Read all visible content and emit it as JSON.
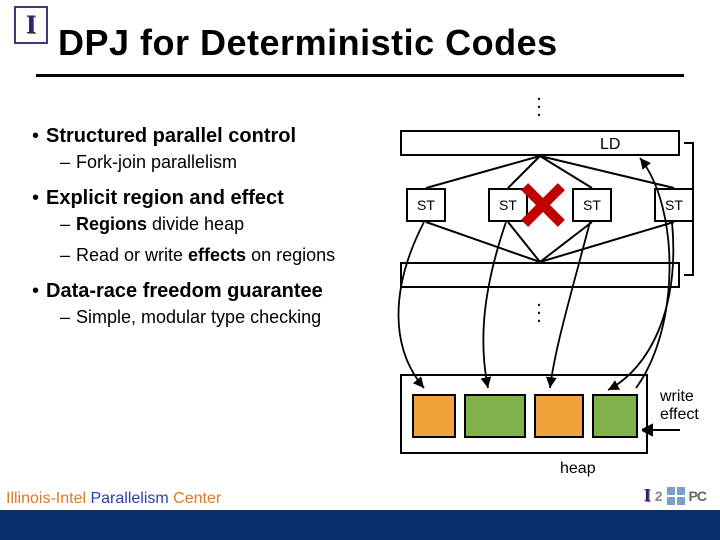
{
  "title": "DPJ for Deterministic Codes",
  "bullets": {
    "b1": "Structured parallel control",
    "b1s1": "Fork-join parallelism",
    "b2": "Explicit region and effect",
    "b2s1a": "Regions",
    "b2s1b": " divide heap",
    "b2s2a": "Read or write ",
    "b2s2b": "effects",
    "b2s2c": " on regions",
    "b3": "Data-race freedom guarantee",
    "b3s1": "Simple, modular type checking"
  },
  "diagram": {
    "ld": "LD",
    "st": "ST",
    "heap": "heap",
    "write_effect_l1": "write",
    "write_effect_l2": "effect"
  },
  "footer": {
    "left_a": "Illinois-Intel ",
    "left_b": "Parallelism ",
    "left_c": "Center",
    "i2pc_i": "I",
    "i2pc_2": "2",
    "i2pc_pc": "PC"
  }
}
